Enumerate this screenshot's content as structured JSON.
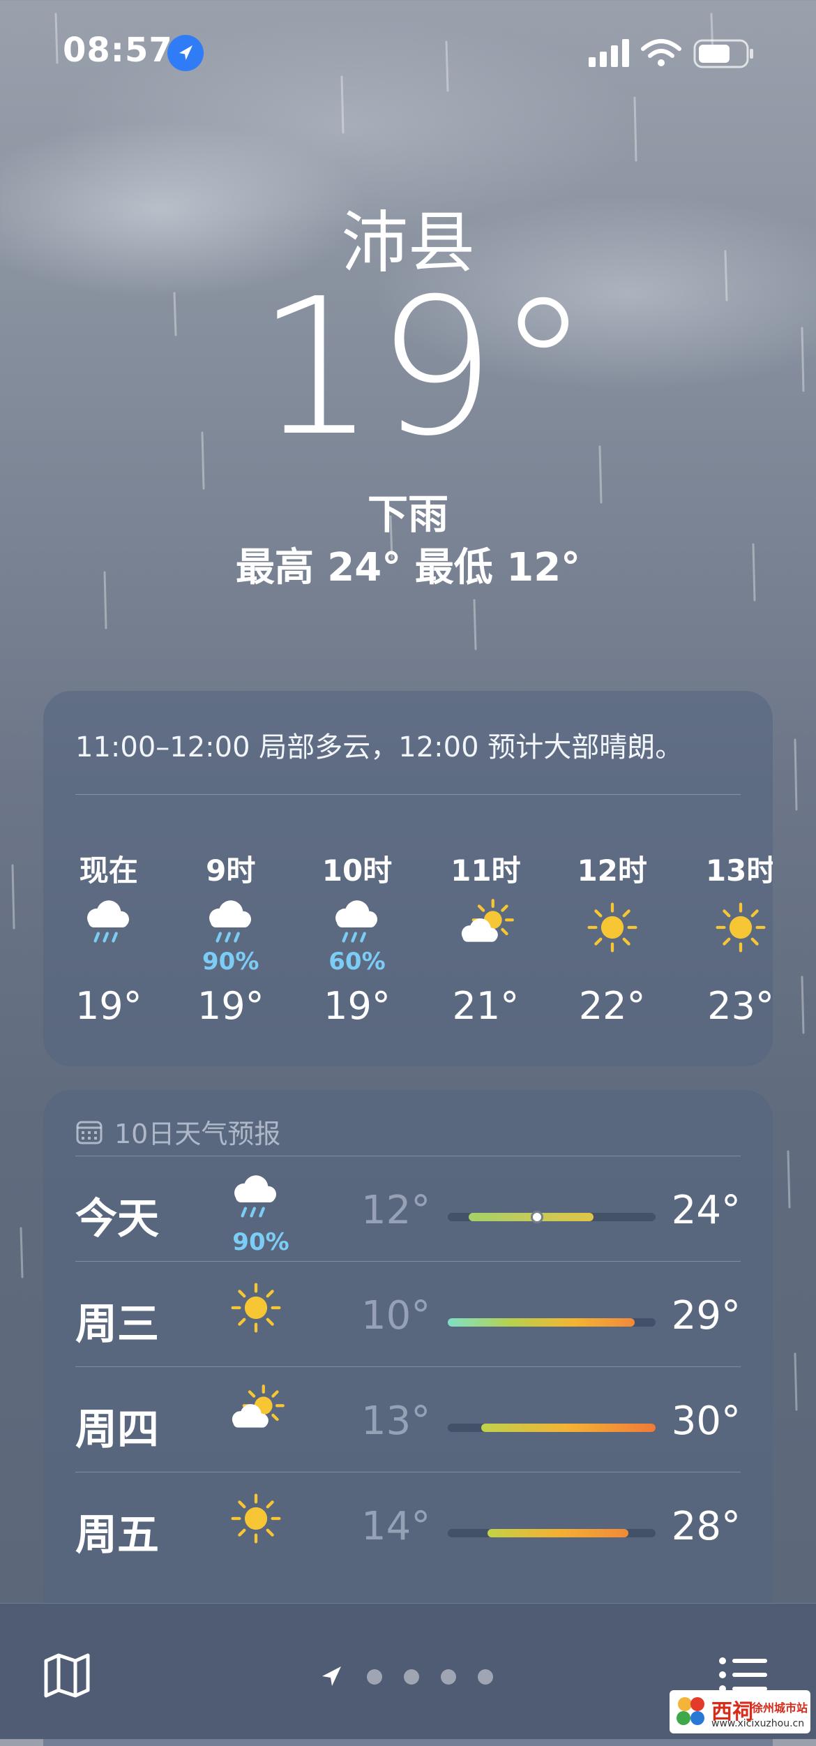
{
  "status": {
    "time": "08:57"
  },
  "header": {
    "city": "沛县",
    "temperature": "19°",
    "condition": "下雨",
    "high_low": "最高 24°  最低 12°"
  },
  "hourly": {
    "summary": "11:00–12:00 局部多云，12:00 预计大部晴朗。",
    "items": [
      {
        "label": "现在",
        "icon": "cloud-rain-icon",
        "precip": "",
        "temp": "19°"
      },
      {
        "label": "9时",
        "icon": "cloud-rain-icon",
        "precip": "90%",
        "temp": "19°"
      },
      {
        "label": "10时",
        "icon": "cloud-rain-icon",
        "precip": "60%",
        "temp": "19°"
      },
      {
        "label": "11时",
        "icon": "partly-cloudy-icon",
        "precip": "",
        "temp": "21°"
      },
      {
        "label": "12时",
        "icon": "sun-icon",
        "precip": "",
        "temp": "22°"
      },
      {
        "label": "13时",
        "icon": "sun-icon",
        "precip": "",
        "temp": "23°"
      }
    ]
  },
  "daily": {
    "title": "10日天气预报",
    "items": [
      {
        "day": "今天",
        "icon": "cloud-rain-icon",
        "precip": "90%",
        "low": "12°",
        "high": "24°",
        "range_start": 0.1,
        "range_end": 0.7,
        "current": 0.43,
        "gradient": [
          "#a6d06a",
          "#e0c547"
        ]
      },
      {
        "day": "周三",
        "icon": "sun-icon",
        "precip": "",
        "low": "10°",
        "high": "29°",
        "range_start": 0.0,
        "range_end": 0.9,
        "gradient": [
          "#7ee0c8",
          "#b6d24e",
          "#f3b533",
          "#f28a3a"
        ]
      },
      {
        "day": "周四",
        "icon": "partly-cloudy-icon",
        "precip": "",
        "low": "13°",
        "high": "30°",
        "range_start": 0.16,
        "range_end": 1.0,
        "gradient": [
          "#bfd24c",
          "#f4b235",
          "#f07a38"
        ]
      },
      {
        "day": "周五",
        "icon": "sun-icon",
        "precip": "",
        "low": "14°",
        "high": "28°",
        "range_start": 0.19,
        "range_end": 0.87,
        "gradient": [
          "#c3d245",
          "#f4b033",
          "#f18a36"
        ]
      }
    ]
  },
  "bottom_bar": {
    "map_icon": "map-icon",
    "location_icon": "location-arrow-icon",
    "list_icon": "list-icon",
    "page_dots": 4
  },
  "watermark": {
    "brand": "西祠",
    "name": "徐州城市站",
    "url": "www.xicixuzhou.cn"
  },
  "colors": {
    "accent_blue": "#2f7cf6",
    "precip_blue": "#7ccdf6",
    "sun_yellow": "#f7c634"
  }
}
